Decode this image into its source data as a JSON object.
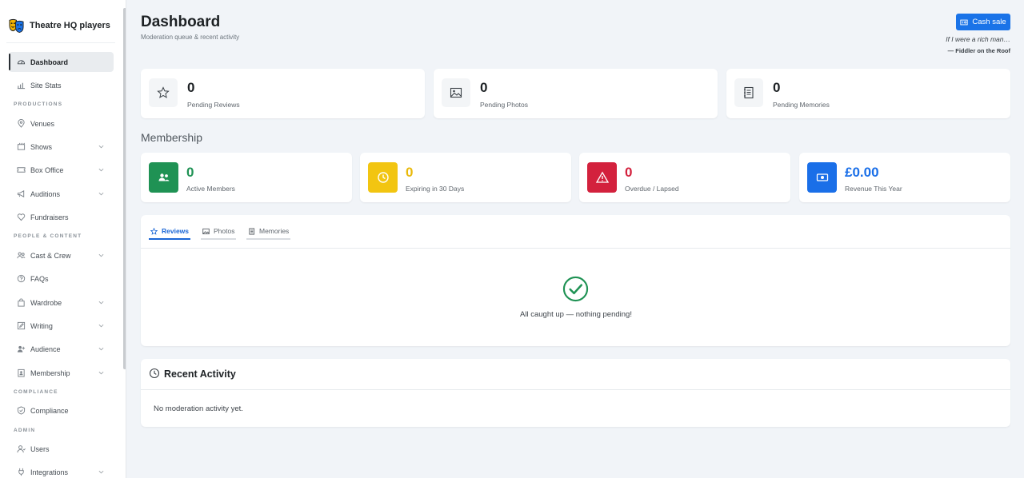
{
  "app": {
    "brand_name": "Theatre HQ players"
  },
  "sidebar": {
    "items": [
      {
        "label": "Dashboard",
        "icon": "gauge-icon",
        "active": true
      },
      {
        "label": "Site Stats",
        "icon": "bar-chart-icon"
      },
      {
        "label": "Venues",
        "icon": "map-pin-icon"
      },
      {
        "label": "Shows",
        "icon": "film-icon"
      },
      {
        "label": "Box Office",
        "icon": "ticket-icon"
      },
      {
        "label": "Auditions",
        "icon": "megaphone-icon"
      },
      {
        "label": "Fundraisers",
        "icon": "heart-icon"
      },
      {
        "label": "Cast & Crew",
        "icon": "people-icon"
      },
      {
        "label": "FAQs",
        "icon": "question-icon"
      },
      {
        "label": "Wardrobe",
        "icon": "bag-icon"
      },
      {
        "label": "Writing",
        "icon": "pencil-icon"
      },
      {
        "label": "Audience",
        "icon": "audience-icon"
      },
      {
        "label": "Membership",
        "icon": "id-card-icon"
      },
      {
        "label": "Compliance",
        "icon": "shield-icon"
      },
      {
        "label": "Users",
        "icon": "users-icon"
      },
      {
        "label": "Integrations",
        "icon": "plug-icon"
      }
    ],
    "sections": {
      "productions": "PRODUCTIONS",
      "people_content": "PEOPLE & CONTENT",
      "compliance": "COMPLIANCE",
      "admin": "ADMIN"
    }
  },
  "header": {
    "title": "Dashboard",
    "subtitle": "Moderation queue & recent activity",
    "cash_sale_label": "Cash sale",
    "quote": "If I were a rich man…",
    "quote_source": "— Fiddler on the Roof"
  },
  "pending": [
    {
      "value": "0",
      "label": "Pending Reviews",
      "icon": "star-icon"
    },
    {
      "value": "0",
      "label": "Pending Photos",
      "icon": "image-icon"
    },
    {
      "value": "0",
      "label": "Pending Memories",
      "icon": "journal-icon"
    }
  ],
  "membership": {
    "title": "Membership",
    "cards": [
      {
        "value": "0",
        "label": "Active Members",
        "icon": "people-icon",
        "color": "#1f9254"
      },
      {
        "value": "0",
        "label": "Expiring in 30 Days",
        "icon": "clock-icon",
        "color": "#f2c511"
      },
      {
        "value": "0",
        "label": "Overdue / Lapsed",
        "icon": "warning-icon",
        "color": "#d3213d"
      },
      {
        "value": "£0.00",
        "label": "Revenue This Year",
        "icon": "cash-icon",
        "color": "#1a6fe8"
      }
    ]
  },
  "tabs": [
    {
      "label": "Reviews",
      "icon": "star-icon",
      "active": true
    },
    {
      "label": "Photos",
      "icon": "image-icon"
    },
    {
      "label": "Memories",
      "icon": "journal-icon"
    }
  ],
  "queue": {
    "empty_message": "All caught up — nothing pending!"
  },
  "recent_activity": {
    "title": "Recent Activity",
    "empty_message": "No moderation activity yet."
  }
}
